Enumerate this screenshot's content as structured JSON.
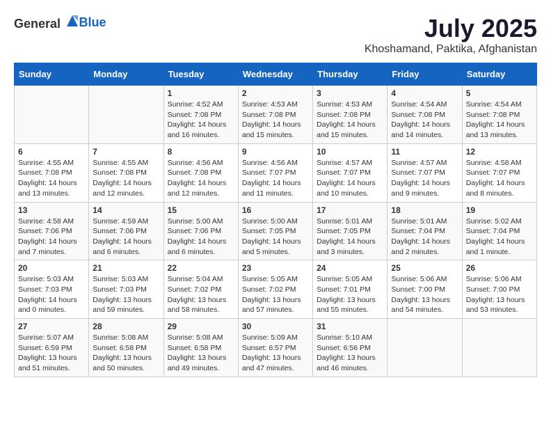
{
  "header": {
    "logo_general": "General",
    "logo_blue": "Blue",
    "month": "July 2025",
    "location": "Khoshamand, Paktika, Afghanistan"
  },
  "days_of_week": [
    "Sunday",
    "Monday",
    "Tuesday",
    "Wednesday",
    "Thursday",
    "Friday",
    "Saturday"
  ],
  "weeks": [
    [
      {
        "day": "",
        "info": ""
      },
      {
        "day": "",
        "info": ""
      },
      {
        "day": "1",
        "info": "Sunrise: 4:52 AM\nSunset: 7:08 PM\nDaylight: 14 hours and 16 minutes."
      },
      {
        "day": "2",
        "info": "Sunrise: 4:53 AM\nSunset: 7:08 PM\nDaylight: 14 hours and 15 minutes."
      },
      {
        "day": "3",
        "info": "Sunrise: 4:53 AM\nSunset: 7:08 PM\nDaylight: 14 hours and 15 minutes."
      },
      {
        "day": "4",
        "info": "Sunrise: 4:54 AM\nSunset: 7:08 PM\nDaylight: 14 hours and 14 minutes."
      },
      {
        "day": "5",
        "info": "Sunrise: 4:54 AM\nSunset: 7:08 PM\nDaylight: 14 hours and 13 minutes."
      }
    ],
    [
      {
        "day": "6",
        "info": "Sunrise: 4:55 AM\nSunset: 7:08 PM\nDaylight: 14 hours and 13 minutes."
      },
      {
        "day": "7",
        "info": "Sunrise: 4:55 AM\nSunset: 7:08 PM\nDaylight: 14 hours and 12 minutes."
      },
      {
        "day": "8",
        "info": "Sunrise: 4:56 AM\nSunset: 7:08 PM\nDaylight: 14 hours and 12 minutes."
      },
      {
        "day": "9",
        "info": "Sunrise: 4:56 AM\nSunset: 7:07 PM\nDaylight: 14 hours and 11 minutes."
      },
      {
        "day": "10",
        "info": "Sunrise: 4:57 AM\nSunset: 7:07 PM\nDaylight: 14 hours and 10 minutes."
      },
      {
        "day": "11",
        "info": "Sunrise: 4:57 AM\nSunset: 7:07 PM\nDaylight: 14 hours and 9 minutes."
      },
      {
        "day": "12",
        "info": "Sunrise: 4:58 AM\nSunset: 7:07 PM\nDaylight: 14 hours and 8 minutes."
      }
    ],
    [
      {
        "day": "13",
        "info": "Sunrise: 4:58 AM\nSunset: 7:06 PM\nDaylight: 14 hours and 7 minutes."
      },
      {
        "day": "14",
        "info": "Sunrise: 4:59 AM\nSunset: 7:06 PM\nDaylight: 14 hours and 6 minutes."
      },
      {
        "day": "15",
        "info": "Sunrise: 5:00 AM\nSunset: 7:06 PM\nDaylight: 14 hours and 6 minutes."
      },
      {
        "day": "16",
        "info": "Sunrise: 5:00 AM\nSunset: 7:05 PM\nDaylight: 14 hours and 5 minutes."
      },
      {
        "day": "17",
        "info": "Sunrise: 5:01 AM\nSunset: 7:05 PM\nDaylight: 14 hours and 3 minutes."
      },
      {
        "day": "18",
        "info": "Sunrise: 5:01 AM\nSunset: 7:04 PM\nDaylight: 14 hours and 2 minutes."
      },
      {
        "day": "19",
        "info": "Sunrise: 5:02 AM\nSunset: 7:04 PM\nDaylight: 14 hours and 1 minute."
      }
    ],
    [
      {
        "day": "20",
        "info": "Sunrise: 5:03 AM\nSunset: 7:03 PM\nDaylight: 14 hours and 0 minutes."
      },
      {
        "day": "21",
        "info": "Sunrise: 5:03 AM\nSunset: 7:03 PM\nDaylight: 13 hours and 59 minutes."
      },
      {
        "day": "22",
        "info": "Sunrise: 5:04 AM\nSunset: 7:02 PM\nDaylight: 13 hours and 58 minutes."
      },
      {
        "day": "23",
        "info": "Sunrise: 5:05 AM\nSunset: 7:02 PM\nDaylight: 13 hours and 57 minutes."
      },
      {
        "day": "24",
        "info": "Sunrise: 5:05 AM\nSunset: 7:01 PM\nDaylight: 13 hours and 55 minutes."
      },
      {
        "day": "25",
        "info": "Sunrise: 5:06 AM\nSunset: 7:00 PM\nDaylight: 13 hours and 54 minutes."
      },
      {
        "day": "26",
        "info": "Sunrise: 5:06 AM\nSunset: 7:00 PM\nDaylight: 13 hours and 53 minutes."
      }
    ],
    [
      {
        "day": "27",
        "info": "Sunrise: 5:07 AM\nSunset: 6:59 PM\nDaylight: 13 hours and 51 minutes."
      },
      {
        "day": "28",
        "info": "Sunrise: 5:08 AM\nSunset: 6:58 PM\nDaylight: 13 hours and 50 minutes."
      },
      {
        "day": "29",
        "info": "Sunrise: 5:08 AM\nSunset: 6:58 PM\nDaylight: 13 hours and 49 minutes."
      },
      {
        "day": "30",
        "info": "Sunrise: 5:09 AM\nSunset: 6:57 PM\nDaylight: 13 hours and 47 minutes."
      },
      {
        "day": "31",
        "info": "Sunrise: 5:10 AM\nSunset: 6:56 PM\nDaylight: 13 hours and 46 minutes."
      },
      {
        "day": "",
        "info": ""
      },
      {
        "day": "",
        "info": ""
      }
    ]
  ]
}
